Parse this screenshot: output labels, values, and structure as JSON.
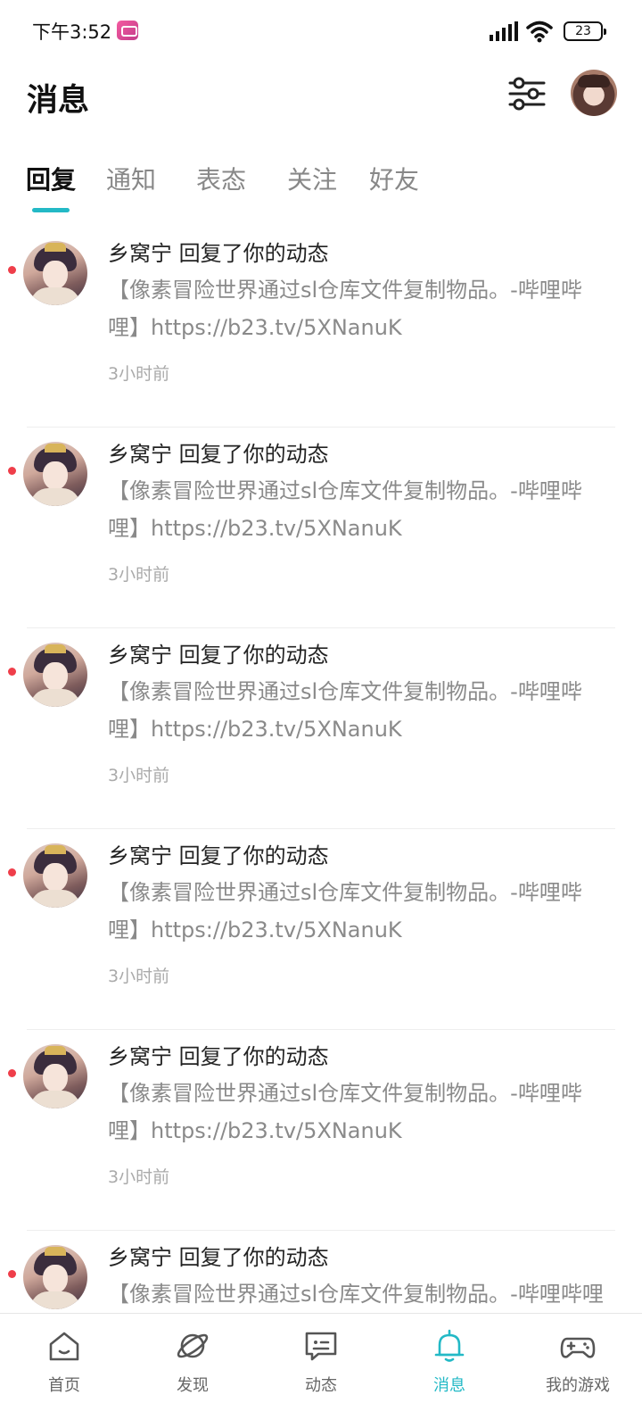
{
  "status_bar": {
    "time": "下午3:52",
    "battery": "23"
  },
  "header": {
    "title": "消息",
    "filter_icon": "sliders-icon",
    "avatar": "user-avatar"
  },
  "tabs": [
    {
      "label": "回复",
      "active": true
    },
    {
      "label": "通知",
      "active": false
    },
    {
      "label": "表态",
      "active": false
    },
    {
      "label": "关注",
      "active": false
    },
    {
      "label": "好友",
      "active": false
    }
  ],
  "accent_color": "#23b9c6",
  "unread_color": "#ef3e4a",
  "messages": [
    {
      "title": "乡窝宁 回复了你的动态",
      "body": "【像素冒险世界通过sl仓库文件复制物品。-哔哩哔哩】https://b23.tv/5XNanuK",
      "time": "3小时前",
      "unread": true
    },
    {
      "title": "乡窝宁 回复了你的动态",
      "body": "【像素冒险世界通过sl仓库文件复制物品。-哔哩哔哩】https://b23.tv/5XNanuK",
      "time": "3小时前",
      "unread": true
    },
    {
      "title": "乡窝宁 回复了你的动态",
      "body": "【像素冒险世界通过sl仓库文件复制物品。-哔哩哔哩】https://b23.tv/5XNanuK",
      "time": "3小时前",
      "unread": true
    },
    {
      "title": "乡窝宁 回复了你的动态",
      "body": "【像素冒险世界通过sl仓库文件复制物品。-哔哩哔哩】https://b23.tv/5XNanuK",
      "time": "3小时前",
      "unread": true
    },
    {
      "title": "乡窝宁 回复了你的动态",
      "body": "【像素冒险世界通过sl仓库文件复制物品。-哔哩哔哩】https://b23.tv/5XNanuK",
      "time": "3小时前",
      "unread": true
    },
    {
      "title": "乡窝宁 回复了你的动态",
      "body": "【像素冒险世界通过sl仓库文件复制物品。-哔哩哔哩",
      "time": "",
      "unread": true
    }
  ],
  "bottom_nav": [
    {
      "label": "首页",
      "icon": "home-icon",
      "active": false
    },
    {
      "label": "发现",
      "icon": "planet-icon",
      "active": false
    },
    {
      "label": "动态",
      "icon": "chat-icon",
      "active": false
    },
    {
      "label": "消息",
      "icon": "bell-icon",
      "active": true
    },
    {
      "label": "我的游戏",
      "icon": "gamepad-icon",
      "active": false
    }
  ]
}
